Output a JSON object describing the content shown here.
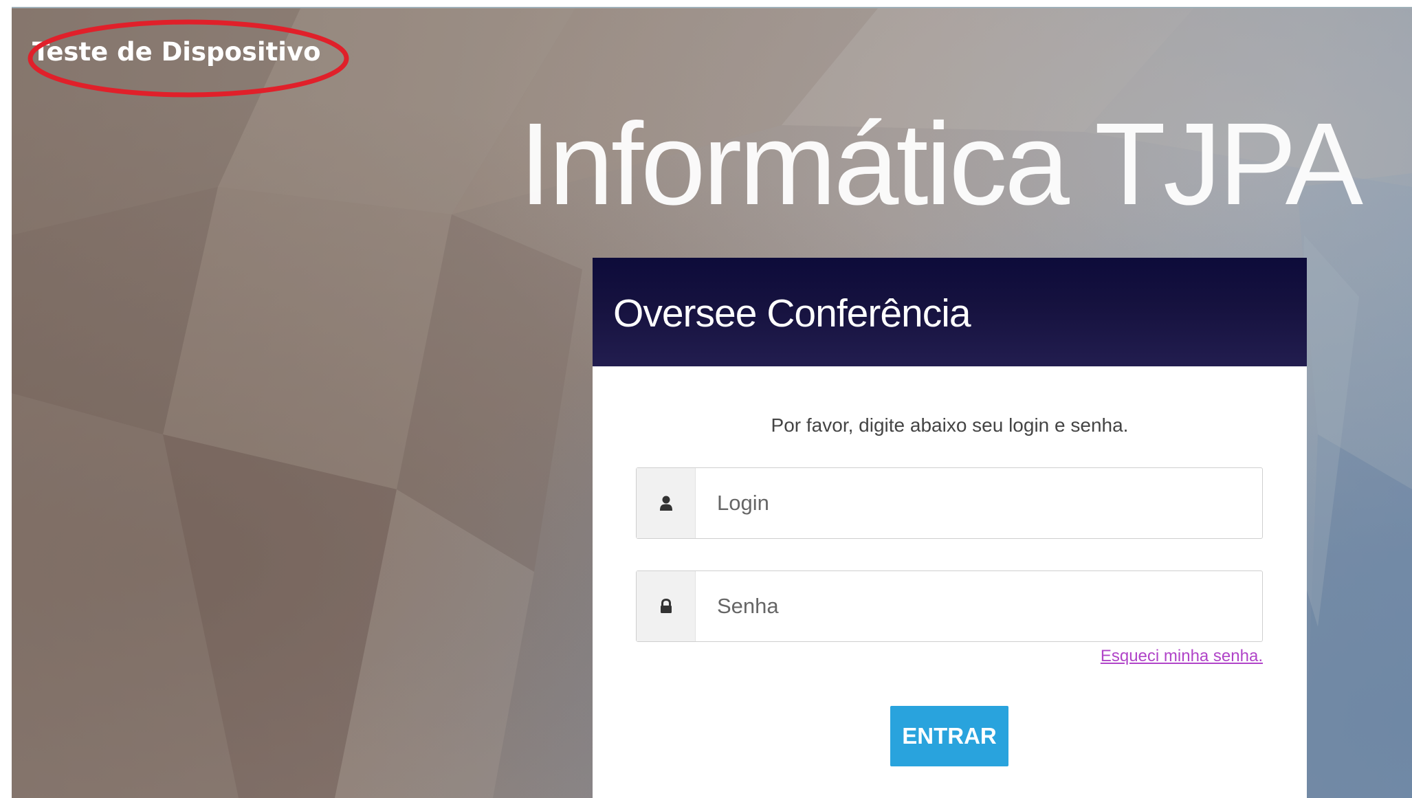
{
  "device": {
    "title": "Teste de Dispositivo"
  },
  "brand": {
    "title": "Informática TJPA"
  },
  "login_card": {
    "header_title": "Oversee Conferência",
    "instruction": "Por favor, digite abaixo seu login e senha.",
    "login_field": {
      "placeholder": "Login",
      "value": "",
      "icon": "user-icon"
    },
    "password_field": {
      "placeholder": "Senha",
      "value": "",
      "icon": "lock-icon"
    },
    "forgot_password_label": "Esqueci minha senha.",
    "submit_label": "ENTRAR"
  },
  "colors": {
    "header_bg": "#14113f",
    "button_bg": "#29a3dd",
    "link": "#b044c8",
    "annotation_ring": "#e0202a"
  }
}
